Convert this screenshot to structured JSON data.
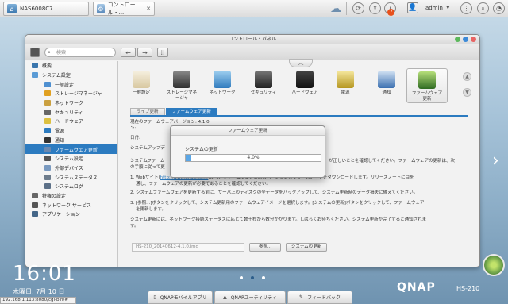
{
  "browser_tabs": [
    {
      "label": "NAS6008C7"
    },
    {
      "label": "コントロール・..."
    }
  ],
  "topbar": {
    "user": "admin",
    "notifications": "7"
  },
  "window": {
    "title": "コントロール・パネル",
    "search_placeholder": "検索"
  },
  "sidebar": [
    {
      "label": "概要",
      "level": 0
    },
    {
      "label": "システム設定",
      "level": 0
    },
    {
      "label": "一般設定",
      "level": 1
    },
    {
      "label": "ストレージマネージャ",
      "level": 1
    },
    {
      "label": "ネットワーク",
      "level": 1
    },
    {
      "label": "セキュリティ",
      "level": 1
    },
    {
      "label": "ハードウェア",
      "level": 1
    },
    {
      "label": "電源",
      "level": 1
    },
    {
      "label": "通知",
      "level": 1
    },
    {
      "label": "ファームウェア更新",
      "level": 1,
      "selected": true
    },
    {
      "label": "システム設定",
      "level": 1
    },
    {
      "label": "外部デバイス",
      "level": 1
    },
    {
      "label": "システムステータス",
      "level": 1
    },
    {
      "label": "システムログ",
      "level": 1
    },
    {
      "label": "特権の設定",
      "level": 0
    },
    {
      "label": "ネットワーク サービス",
      "level": 0
    },
    {
      "label": "アプリケーション",
      "level": 0
    }
  ],
  "categories": [
    {
      "label": "一般設定",
      "icon": "general-settings-icon"
    },
    {
      "label": "ストレージマネ\nージャ",
      "icon": "storage-icon"
    },
    {
      "label": "ネットワーク",
      "icon": "network-icon"
    },
    {
      "label": "セキュリティ",
      "icon": "lock-icon"
    },
    {
      "label": "ハードウェア",
      "icon": "hardware-icon"
    },
    {
      "label": "電源",
      "icon": "power-bulb-icon"
    },
    {
      "label": "通知",
      "icon": "notification-icon"
    },
    {
      "label": "ファームウェア\n更新",
      "icon": "firmware-icon",
      "active": true
    }
  ],
  "subtabs": [
    {
      "label": "ライブ更新"
    },
    {
      "label": "ファームウェア更新",
      "active": true
    }
  ],
  "content": {
    "version_label": "現在のファームウェアバージョン:",
    "version_value": "4.1.0",
    "version_suffix": "ン:",
    "date_label": "日付:",
    "upload_label": "システムアップデ",
    "intro": "システムファーム",
    "intro_right": "が正しいことを確認してください。ファームウェアの更新は、次",
    "intro2": "の手順に従って更",
    "step1_a": "1. Webサイト(",
    "step1_link": "http://www.qnap.com/",
    "step1_b": ")から、ファームウェアと同じバージョンのリリースノートをダウンロードします。リリースノートに目を",
    "step1_c": "通し、ファームウェアの更新が必要であることを確認してください。",
    "step2": "2. システムファームウェアを更新する前に、サーバ上のディスクの全データをバックアップして、システム更新時のデータ損失に備えてください。",
    "step3_a": "3. [参照...]ボタンをクリックして、システム更新用のファームウェアイメージを選択します。[システムの更新]ボタンをクリックして、ファームウェア",
    "step3_b": "を更新します。",
    "note_a": "システム更新には、ネットワーク接続ステータスに応じて数十秒から数分かかります。しばらくお待ちください。システム更新が完了すると通知されま",
    "note_b": "す。",
    "file_value": "HS-210_20140612-4.1.0.img",
    "browse_label": "参照...",
    "update_label": "システムの更新"
  },
  "dialog": {
    "title": "ファームウェア更新",
    "label": "システムの更新",
    "progress": 0.04,
    "progress_text": "4.0%"
  },
  "desktop": {
    "time": "16:01",
    "date": "木曜日, 7月 10 日",
    "status_url": "192.168.1.113:8080/cgi-bin/#",
    "brand": "QNAP",
    "model": "HS-210"
  },
  "dock": [
    {
      "label": "QNAPモバイルアプリ"
    },
    {
      "label": "QNAPユーティリティ"
    },
    {
      "label": "フィードバック"
    }
  ],
  "colors": {
    "accent": "#2c7bc0",
    "progress": "#5aa6e6"
  }
}
